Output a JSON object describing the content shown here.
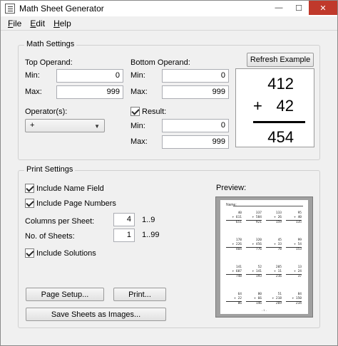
{
  "window": {
    "title": "Math Sheet Generator",
    "minimize": "—",
    "maximize": "☐",
    "close": "✕"
  },
  "menu": [
    {
      "label": "File"
    },
    {
      "label": "Edit"
    },
    {
      "label": "Help"
    }
  ],
  "math_settings": {
    "title": "Math Settings",
    "top_operand": {
      "label": "Top Operand:",
      "min_label": "Min:",
      "min_value": "0",
      "max_label": "Max:",
      "max_value": "999"
    },
    "bottom_operand": {
      "label": "Bottom Operand:",
      "min_label": "Min:",
      "min_value": "0",
      "max_label": "Max:",
      "max_value": "999"
    },
    "operators": {
      "label": "Operator(s):",
      "selected": "+"
    },
    "result": {
      "label": "Result:",
      "checked": true,
      "min_label": "Min:",
      "min_value": "0",
      "max_label": "Max:",
      "max_value": "999"
    },
    "refresh_button": "Refresh Example",
    "example": {
      "top": "412",
      "operator": "+",
      "bottom": "42",
      "answer": "454"
    }
  },
  "print_settings": {
    "title": "Print Settings",
    "include_name_field": {
      "label": "Include Name Field",
      "checked": true
    },
    "include_page_numbers": {
      "label": "Include Page Numbers",
      "checked": true
    },
    "columns": {
      "label": "Columns per Sheet:",
      "value": "4",
      "range": "1..9"
    },
    "sheets": {
      "label": "No. of Sheets:",
      "value": "1",
      "range": "1..99"
    },
    "include_solutions": {
      "label": "Include Solutions",
      "checked": true
    },
    "page_setup_button": "Page Setup...",
    "print_button": "Print...",
    "save_images_button": "Save Sheets as Images...",
    "preview_label": "Preview:",
    "preview": {
      "name_label": "Name:",
      "problems": [
        [
          "40",
          "+ 611",
          "651"
        ],
        [
          "337",
          "+ 584",
          "921"
        ],
        [
          "133",
          "+ 26",
          "159"
        ],
        [
          "95",
          "+ 40",
          "135"
        ],
        [
          "178",
          "+ 226",
          "404"
        ],
        [
          "320",
          "+ 456",
          "776"
        ],
        [
          "45",
          "+ 33",
          "78"
        ],
        [
          "99",
          "+ 54",
          "153"
        ],
        [
          "141",
          "+ 607",
          "748"
        ],
        [
          "52",
          "+ 141",
          "193"
        ],
        [
          "205",
          "+ 11",
          "216"
        ],
        [
          "13",
          "+ 24",
          "37"
        ],
        [
          "64",
          "+ 22",
          "86"
        ],
        [
          "80",
          "+ 66",
          "146"
        ],
        [
          "51",
          "+ 218",
          "269"
        ],
        [
          "84",
          "+ 150",
          "234"
        ]
      ],
      "footer": "- 1 -"
    }
  }
}
